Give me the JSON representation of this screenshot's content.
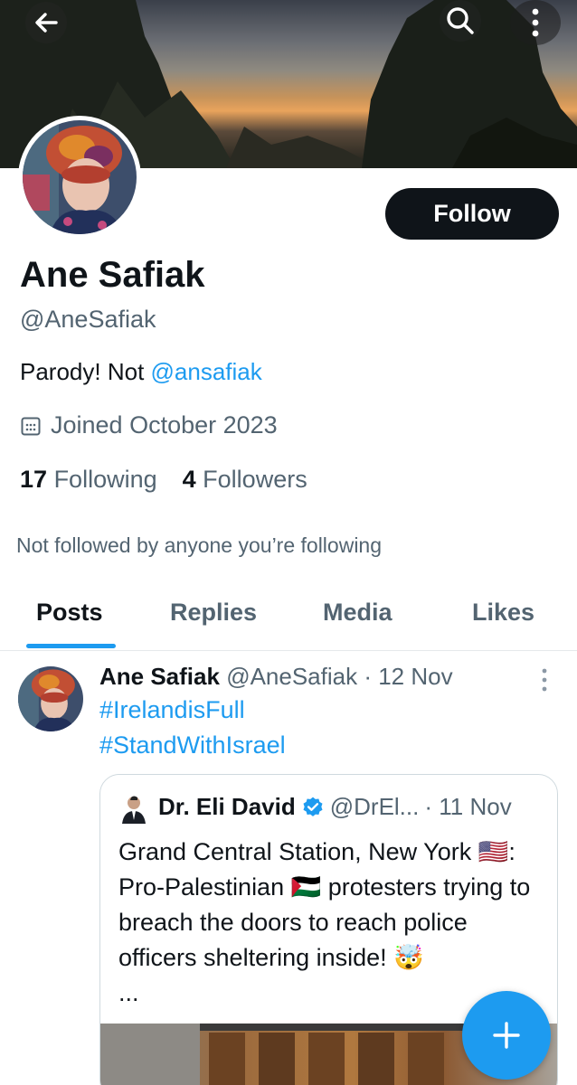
{
  "profile": {
    "follow_label": "Follow",
    "name": "Ane Safiak",
    "handle": "@AneSafiak",
    "bio_prefix": "Parody! Not ",
    "bio_link": "@ansafiak",
    "joined": "Joined October 2023",
    "following_count": "17",
    "following_label": "Following",
    "followers_count": "4",
    "followers_label": "Followers",
    "not_followed": "Not followed by anyone you’re following"
  },
  "tabs": [
    {
      "label": "Posts",
      "active": true
    },
    {
      "label": "Replies",
      "active": false
    },
    {
      "label": "Media",
      "active": false
    },
    {
      "label": "Likes",
      "active": false
    }
  ],
  "post": {
    "author": "Ane Safiak",
    "handle": "@AneSafiak",
    "time": "· 12 Nov",
    "hashtags": [
      "#IrelandisFull",
      "#StandWithIsrael"
    ],
    "quote": {
      "author": "Dr. Eli David",
      "handle": "@DrEl...",
      "time": "· 11 Nov",
      "text": "Grand Central Station, New York 🇺🇸: Pro-Palestinian 🇵🇸 protesters trying to breach the doors to reach police officers sheltering inside! 🤯",
      "ellipsis": "..."
    }
  },
  "icons": [
    "back-arrow-icon",
    "search-icon",
    "more-vertical-icon",
    "calendar-icon",
    "verified-badge-icon",
    "plus-icon"
  ],
  "colors": {
    "accent": "#1d9bf0",
    "text": "#0f1419",
    "muted": "#536471",
    "follow_bg": "#0f1419"
  }
}
